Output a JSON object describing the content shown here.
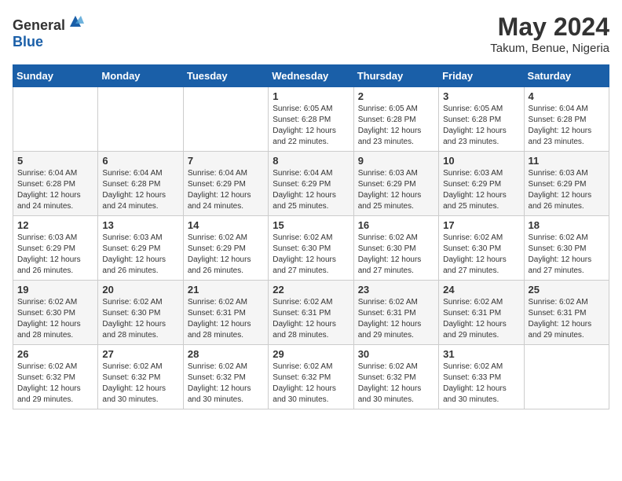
{
  "logo": {
    "general": "General",
    "blue": "Blue"
  },
  "title": "May 2024",
  "subtitle": "Takum, Benue, Nigeria",
  "weekdays": [
    "Sunday",
    "Monday",
    "Tuesday",
    "Wednesday",
    "Thursday",
    "Friday",
    "Saturday"
  ],
  "weeks": [
    [
      {
        "day": "",
        "sunrise": "",
        "sunset": "",
        "daylight": ""
      },
      {
        "day": "",
        "sunrise": "",
        "sunset": "",
        "daylight": ""
      },
      {
        "day": "",
        "sunrise": "",
        "sunset": "",
        "daylight": ""
      },
      {
        "day": "1",
        "sunrise": "Sunrise: 6:05 AM",
        "sunset": "Sunset: 6:28 PM",
        "daylight": "Daylight: 12 hours and 22 minutes."
      },
      {
        "day": "2",
        "sunrise": "Sunrise: 6:05 AM",
        "sunset": "Sunset: 6:28 PM",
        "daylight": "Daylight: 12 hours and 23 minutes."
      },
      {
        "day": "3",
        "sunrise": "Sunrise: 6:05 AM",
        "sunset": "Sunset: 6:28 PM",
        "daylight": "Daylight: 12 hours and 23 minutes."
      },
      {
        "day": "4",
        "sunrise": "Sunrise: 6:04 AM",
        "sunset": "Sunset: 6:28 PM",
        "daylight": "Daylight: 12 hours and 23 minutes."
      }
    ],
    [
      {
        "day": "5",
        "sunrise": "Sunrise: 6:04 AM",
        "sunset": "Sunset: 6:28 PM",
        "daylight": "Daylight: 12 hours and 24 minutes."
      },
      {
        "day": "6",
        "sunrise": "Sunrise: 6:04 AM",
        "sunset": "Sunset: 6:28 PM",
        "daylight": "Daylight: 12 hours and 24 minutes."
      },
      {
        "day": "7",
        "sunrise": "Sunrise: 6:04 AM",
        "sunset": "Sunset: 6:29 PM",
        "daylight": "Daylight: 12 hours and 24 minutes."
      },
      {
        "day": "8",
        "sunrise": "Sunrise: 6:04 AM",
        "sunset": "Sunset: 6:29 PM",
        "daylight": "Daylight: 12 hours and 25 minutes."
      },
      {
        "day": "9",
        "sunrise": "Sunrise: 6:03 AM",
        "sunset": "Sunset: 6:29 PM",
        "daylight": "Daylight: 12 hours and 25 minutes."
      },
      {
        "day": "10",
        "sunrise": "Sunrise: 6:03 AM",
        "sunset": "Sunset: 6:29 PM",
        "daylight": "Daylight: 12 hours and 25 minutes."
      },
      {
        "day": "11",
        "sunrise": "Sunrise: 6:03 AM",
        "sunset": "Sunset: 6:29 PM",
        "daylight": "Daylight: 12 hours and 26 minutes."
      }
    ],
    [
      {
        "day": "12",
        "sunrise": "Sunrise: 6:03 AM",
        "sunset": "Sunset: 6:29 PM",
        "daylight": "Daylight: 12 hours and 26 minutes."
      },
      {
        "day": "13",
        "sunrise": "Sunrise: 6:03 AM",
        "sunset": "Sunset: 6:29 PM",
        "daylight": "Daylight: 12 hours and 26 minutes."
      },
      {
        "day": "14",
        "sunrise": "Sunrise: 6:02 AM",
        "sunset": "Sunset: 6:29 PM",
        "daylight": "Daylight: 12 hours and 26 minutes."
      },
      {
        "day": "15",
        "sunrise": "Sunrise: 6:02 AM",
        "sunset": "Sunset: 6:30 PM",
        "daylight": "Daylight: 12 hours and 27 minutes."
      },
      {
        "day": "16",
        "sunrise": "Sunrise: 6:02 AM",
        "sunset": "Sunset: 6:30 PM",
        "daylight": "Daylight: 12 hours and 27 minutes."
      },
      {
        "day": "17",
        "sunrise": "Sunrise: 6:02 AM",
        "sunset": "Sunset: 6:30 PM",
        "daylight": "Daylight: 12 hours and 27 minutes."
      },
      {
        "day": "18",
        "sunrise": "Sunrise: 6:02 AM",
        "sunset": "Sunset: 6:30 PM",
        "daylight": "Daylight: 12 hours and 27 minutes."
      }
    ],
    [
      {
        "day": "19",
        "sunrise": "Sunrise: 6:02 AM",
        "sunset": "Sunset: 6:30 PM",
        "daylight": "Daylight: 12 hours and 28 minutes."
      },
      {
        "day": "20",
        "sunrise": "Sunrise: 6:02 AM",
        "sunset": "Sunset: 6:30 PM",
        "daylight": "Daylight: 12 hours and 28 minutes."
      },
      {
        "day": "21",
        "sunrise": "Sunrise: 6:02 AM",
        "sunset": "Sunset: 6:31 PM",
        "daylight": "Daylight: 12 hours and 28 minutes."
      },
      {
        "day": "22",
        "sunrise": "Sunrise: 6:02 AM",
        "sunset": "Sunset: 6:31 PM",
        "daylight": "Daylight: 12 hours and 28 minutes."
      },
      {
        "day": "23",
        "sunrise": "Sunrise: 6:02 AM",
        "sunset": "Sunset: 6:31 PM",
        "daylight": "Daylight: 12 hours and 29 minutes."
      },
      {
        "day": "24",
        "sunrise": "Sunrise: 6:02 AM",
        "sunset": "Sunset: 6:31 PM",
        "daylight": "Daylight: 12 hours and 29 minutes."
      },
      {
        "day": "25",
        "sunrise": "Sunrise: 6:02 AM",
        "sunset": "Sunset: 6:31 PM",
        "daylight": "Daylight: 12 hours and 29 minutes."
      }
    ],
    [
      {
        "day": "26",
        "sunrise": "Sunrise: 6:02 AM",
        "sunset": "Sunset: 6:32 PM",
        "daylight": "Daylight: 12 hours and 29 minutes."
      },
      {
        "day": "27",
        "sunrise": "Sunrise: 6:02 AM",
        "sunset": "Sunset: 6:32 PM",
        "daylight": "Daylight: 12 hours and 30 minutes."
      },
      {
        "day": "28",
        "sunrise": "Sunrise: 6:02 AM",
        "sunset": "Sunset: 6:32 PM",
        "daylight": "Daylight: 12 hours and 30 minutes."
      },
      {
        "day": "29",
        "sunrise": "Sunrise: 6:02 AM",
        "sunset": "Sunset: 6:32 PM",
        "daylight": "Daylight: 12 hours and 30 minutes."
      },
      {
        "day": "30",
        "sunrise": "Sunrise: 6:02 AM",
        "sunset": "Sunset: 6:32 PM",
        "daylight": "Daylight: 12 hours and 30 minutes."
      },
      {
        "day": "31",
        "sunrise": "Sunrise: 6:02 AM",
        "sunset": "Sunset: 6:33 PM",
        "daylight": "Daylight: 12 hours and 30 minutes."
      },
      {
        "day": "",
        "sunrise": "",
        "sunset": "",
        "daylight": ""
      }
    ]
  ]
}
